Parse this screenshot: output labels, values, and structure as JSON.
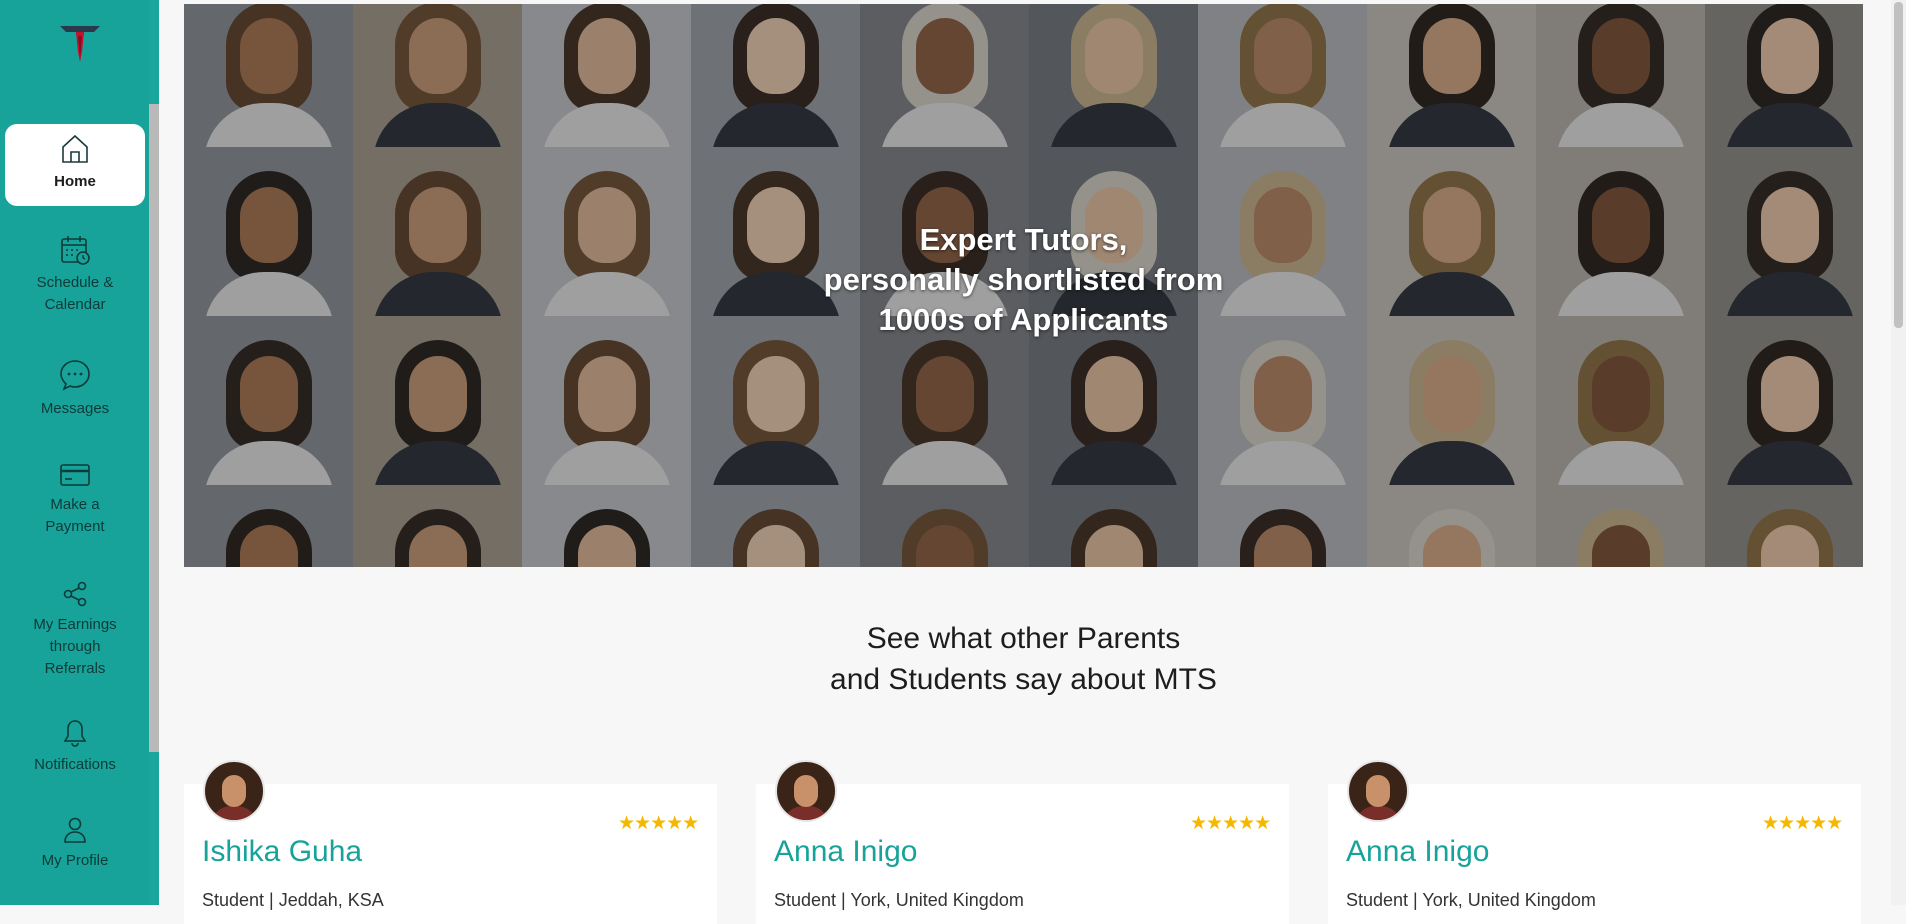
{
  "sidebar": {
    "items": [
      {
        "label_line1": "Home",
        "label_line2": "",
        "label_line3": "",
        "icon": "home-icon",
        "active": true
      },
      {
        "label_line1": "Schedule &",
        "label_line2": "Calendar",
        "label_line3": "",
        "icon": "calendar-icon",
        "active": false
      },
      {
        "label_line1": "Messages",
        "label_line2": "",
        "label_line3": "",
        "icon": "message-icon",
        "active": false
      },
      {
        "label_line1": "Make a",
        "label_line2": "Payment",
        "label_line3": "",
        "icon": "credit-card-icon",
        "active": false
      },
      {
        "label_line1": "My Earnings",
        "label_line2": "through",
        "label_line3": "Referrals",
        "icon": "share-icon",
        "active": false
      },
      {
        "label_line1": "Notifications",
        "label_line2": "",
        "label_line3": "",
        "icon": "bell-icon",
        "active": false
      },
      {
        "label_line1": "My Profile",
        "label_line2": "",
        "label_line3": "",
        "icon": "user-icon",
        "active": false
      }
    ]
  },
  "hero": {
    "line1": "Expert Tutors,",
    "line2": "personally shortlisted from",
    "line3": "1000s of Applicants"
  },
  "testimonials": {
    "heading_line1": "See what other Parents",
    "heading_line2": "and Students say about MTS",
    "cards": [
      {
        "name": "Ishika Guha",
        "role": "Student | Jeddah, KSA",
        "rating": 5,
        "stars": "★★★★★"
      },
      {
        "name": "Anna Inigo",
        "role": "Student | York, United Kingdom",
        "rating": 5,
        "stars": "★★★★★"
      },
      {
        "name": "Anna Inigo",
        "role": "Student | York, United Kingdom",
        "rating": 5,
        "stars": "★★★★★"
      }
    ]
  },
  "colors": {
    "accent": "#17a39a",
    "star": "#f5b800"
  }
}
